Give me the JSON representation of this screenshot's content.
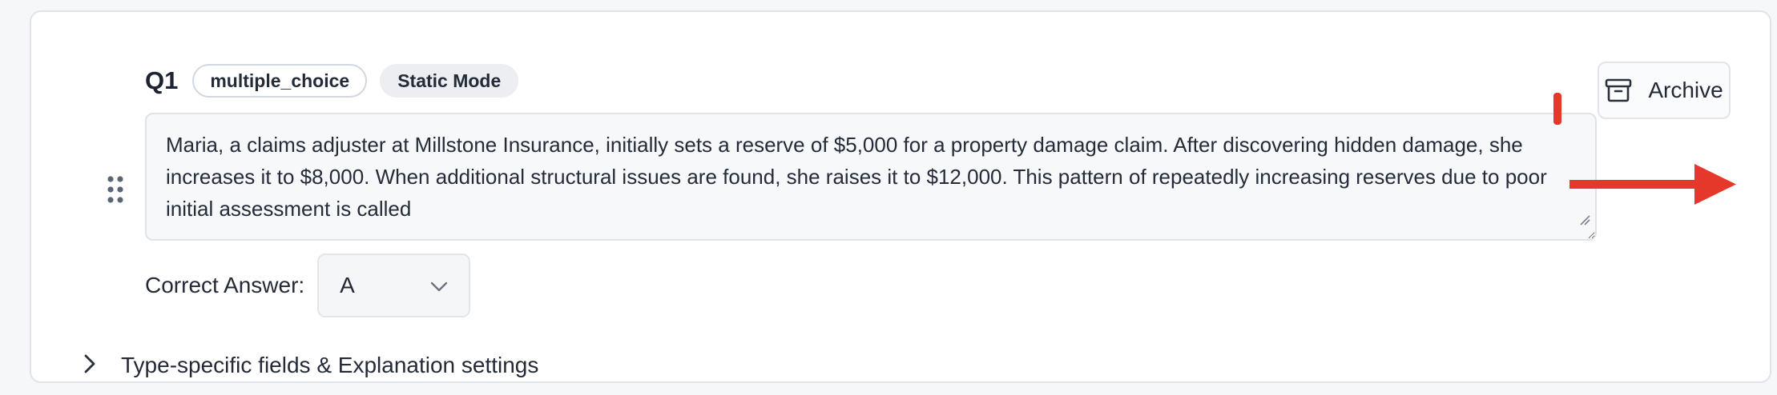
{
  "question": {
    "number": "Q1",
    "type_badge": "multiple_choice",
    "mode_badge": "Static Mode",
    "text": "Maria, a claims adjuster at Millstone Insurance, initially sets a reserve of $5,000 for a property damage claim. After discovering hidden damage, she increases it to $8,000. When additional structural issues are found, she raises it to $12,000. This pattern of repeatedly increasing reserves due to poor initial assessment is called"
  },
  "actions": {
    "archive_label": "Archive"
  },
  "correct_answer": {
    "label": "Correct Answer:",
    "value": "A"
  },
  "expander": {
    "label": "Type-specific fields & Explanation settings"
  },
  "icons": {
    "drag": "drag-handle-icon",
    "archive": "archive-icon",
    "select": "chevron-down-icon",
    "expander": "chevron-right-icon"
  },
  "colors": {
    "annotation": "#e6382a",
    "card_border": "#dfe3ea",
    "text": "#1f2533"
  }
}
